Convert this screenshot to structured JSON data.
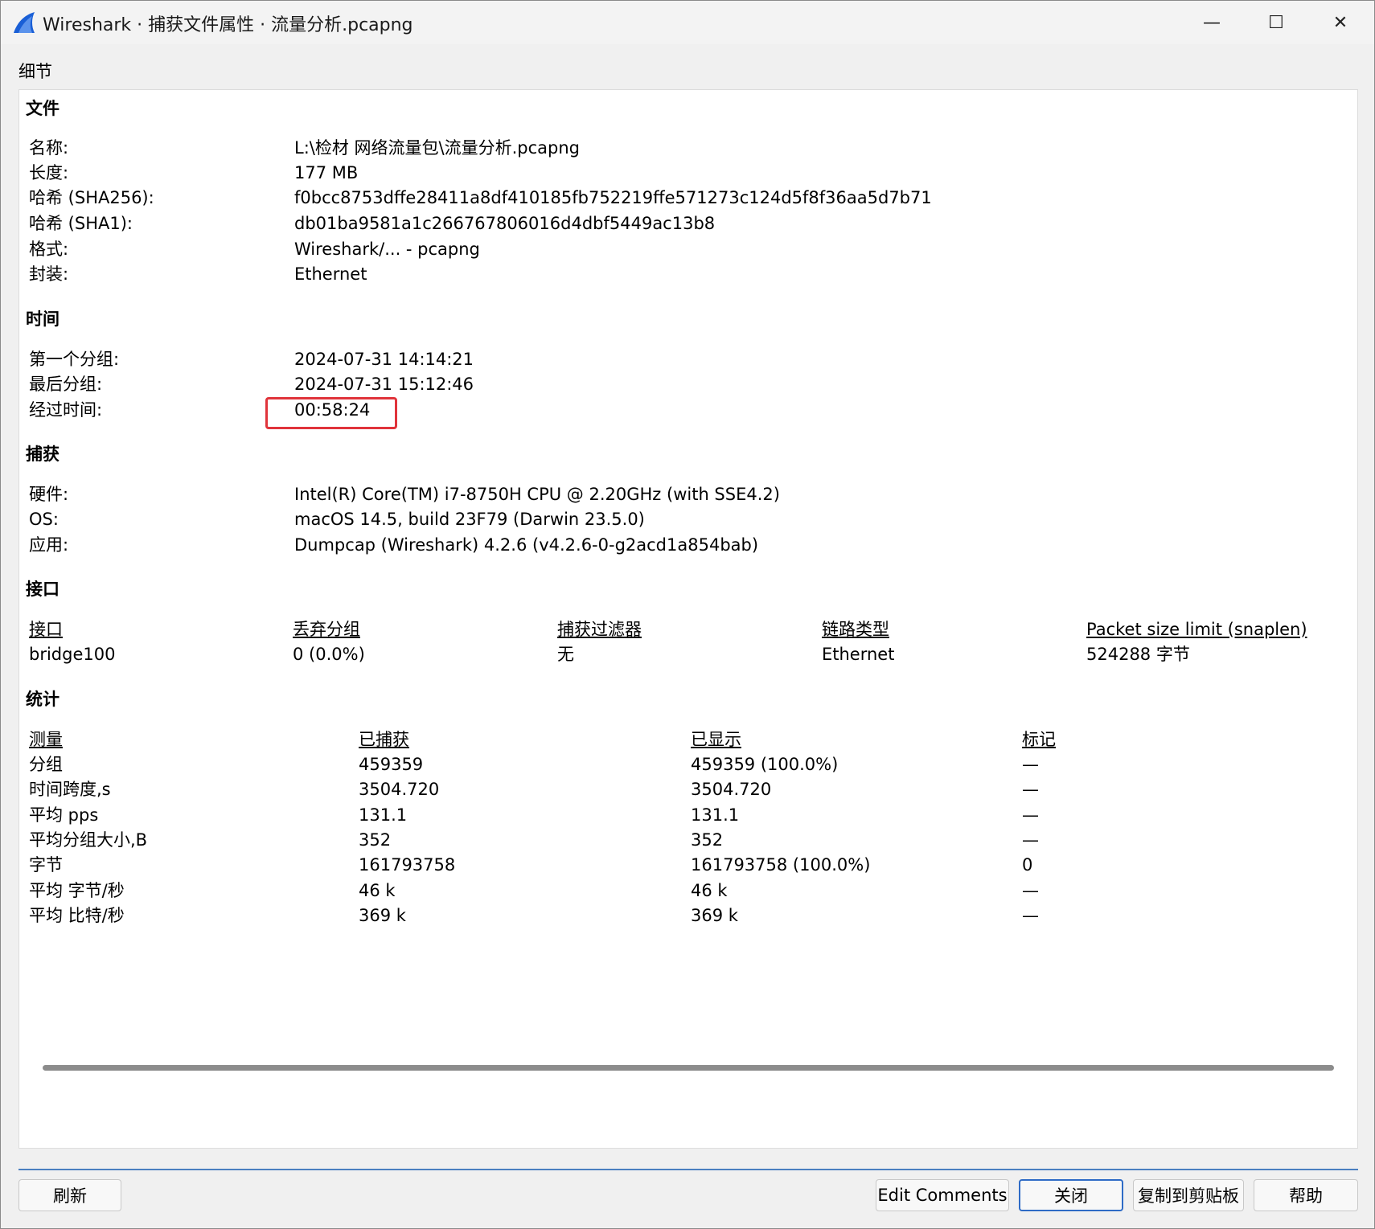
{
  "window": {
    "title": "Wireshark · 捕获文件属性 · 流量分析.pcapng",
    "minimize_glyph": "—",
    "maximize_glyph": "☐",
    "close_glyph": "✕",
    "app_icon": "wireshark-fin-icon",
    "accent_color": "#1a5fd6"
  },
  "caption": "细节",
  "file": {
    "header": "文件",
    "rows": [
      {
        "label": "名称:",
        "value": "L:\\检材 网络流量包\\流量分析.pcapng"
      },
      {
        "label": "长度:",
        "value": "177 MB"
      },
      {
        "label": "哈希 (SHA256):",
        "value": "f0bcc8753dffe28411a8df410185fb752219ffe571273c124d5f8f36aa5d7b71"
      },
      {
        "label": "哈希 (SHA1):",
        "value": "db01ba9581a1c266767806016d4dbf5449ac13b8"
      },
      {
        "label": "格式:",
        "value": "Wireshark/... - pcapng"
      },
      {
        "label": "封装:",
        "value": "Ethernet"
      }
    ]
  },
  "time": {
    "header": "时间",
    "rows": [
      {
        "label": "第一个分组:",
        "value": "2024-07-31 14:14:21"
      },
      {
        "label": "最后分组:",
        "value": "2024-07-31 15:12:46"
      },
      {
        "label": "经过时间:",
        "value": "00:58:24"
      }
    ],
    "highlight_color": "#e0343b"
  },
  "capture": {
    "header": "捕获",
    "rows": [
      {
        "label": "硬件:",
        "value": "Intel(R) Core(TM) i7-8750H CPU @ 2.20GHz (with SSE4.2)"
      },
      {
        "label": "OS:",
        "value": "macOS 14.5, build 23F79 (Darwin 23.5.0)"
      },
      {
        "label": "应用:",
        "value": "Dumpcap (Wireshark) 4.2.6 (v4.2.6-0-g2acd1a854bab)"
      }
    ]
  },
  "interfaces": {
    "header": "接口",
    "columns": [
      "接口",
      "丢弃分组",
      "捕获过滤器",
      "链路类型",
      "Packet size limit (snaplen)"
    ],
    "row": [
      "bridge100",
      "0 (0.0%)",
      "无",
      "Ethernet",
      "524288 字节"
    ]
  },
  "stats": {
    "header": "统计",
    "columns": [
      "测量",
      "已捕获",
      "已显示",
      "标记"
    ],
    "rows": [
      [
        "分组",
        "459359",
        "459359 (100.0%)",
        "—"
      ],
      [
        "时间跨度,s",
        "3504.720",
        "3504.720",
        "—"
      ],
      [
        "平均 pps",
        "131.1",
        "131.1",
        "—"
      ],
      [
        "平均分组大小,B",
        "352",
        "352",
        "—"
      ],
      [
        "字节",
        "161793758",
        "161793758 (100.0%)",
        "0"
      ],
      [
        "平均 字节/秒",
        "46 k",
        "46 k",
        "—"
      ],
      [
        "平均 比特/秒",
        "369 k",
        "369 k",
        "—"
      ]
    ]
  },
  "buttons": {
    "refresh": "刷新",
    "edit_comments": "Edit Comments",
    "close": "关闭",
    "copy": "复制到剪贴板",
    "help": "帮助"
  }
}
